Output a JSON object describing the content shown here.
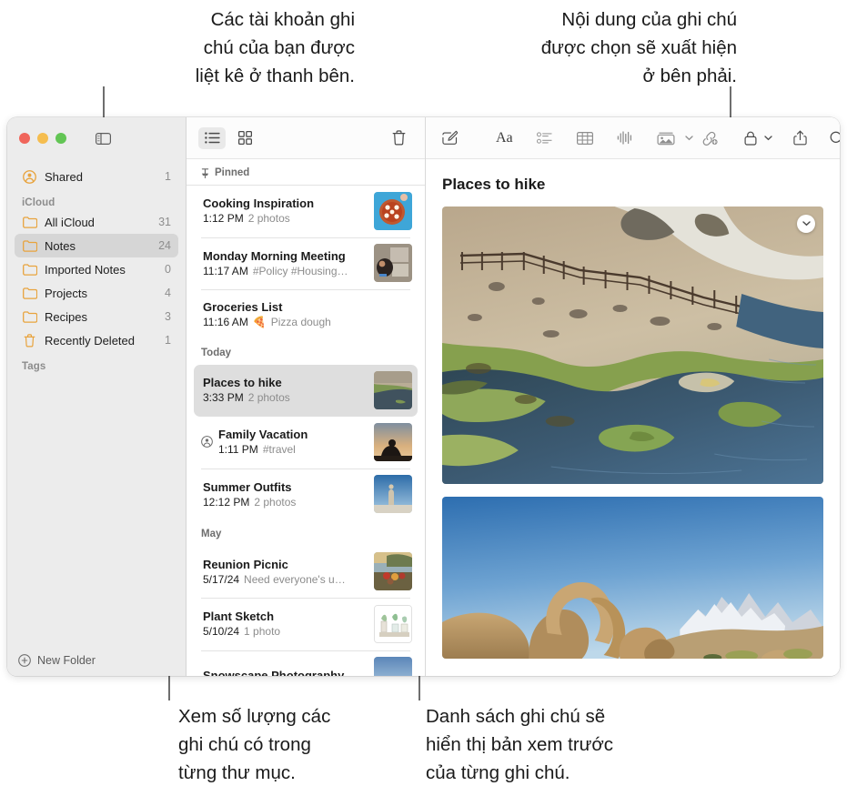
{
  "callouts": {
    "top_left": "Các tài khoản ghi\nchú của bạn được\nliệt kê ở thanh bên.",
    "top_right": "Nội dung của ghi chú\nđược chọn sẽ xuất hiện\nở bên phải.",
    "bottom_left": "Xem số lượng các\nghi chú có trong\ntừng thư mục.",
    "bottom_right": "Danh sách ghi chú sẽ\nhiển thị bản xem trước\ncủa từng ghi chú."
  },
  "window": {
    "traffic_lights": {
      "close": "close-button",
      "minimize": "minimize-button",
      "zoom": "zoom-button"
    },
    "sidebar_toggle": "sidebar-toggle"
  },
  "sidebar": {
    "shared": {
      "label": "Shared",
      "count": "1"
    },
    "sections": [
      {
        "title": "iCloud",
        "items": [
          {
            "label": "All iCloud",
            "count": "31",
            "icon": "folder-icon",
            "selected": false
          },
          {
            "label": "Notes",
            "count": "24",
            "icon": "folder-icon",
            "selected": true
          },
          {
            "label": "Imported Notes",
            "count": "0",
            "icon": "folder-icon",
            "selected": false
          },
          {
            "label": "Projects",
            "count": "4",
            "icon": "folder-icon",
            "selected": false
          },
          {
            "label": "Recipes",
            "count": "3",
            "icon": "folder-icon",
            "selected": false
          },
          {
            "label": "Recently Deleted",
            "count": "1",
            "icon": "trash-icon",
            "selected": false
          }
        ]
      },
      {
        "title": "Tags",
        "items": []
      }
    ],
    "new_folder_label": "New Folder"
  },
  "notes_list": {
    "toolbar": {
      "list_view": "list-view-icon",
      "gallery_view": "gallery-view-icon",
      "delete": "trash-icon"
    },
    "groups": [
      {
        "label": "Pinned",
        "icon": "pin-icon",
        "notes": [
          {
            "title": "Cooking Inspiration",
            "time": "1:12 PM",
            "preview": "2 photos",
            "thumb": "pizza",
            "shared": false,
            "selected": false
          },
          {
            "title": "Monday Morning Meeting",
            "time": "11:17 AM",
            "preview": "#Policy #Housing…",
            "thumb": "meeting",
            "shared": false,
            "selected": false
          },
          {
            "title": "Groceries List",
            "time": "11:16 AM",
            "preview": "Pizza dough",
            "emoji": "🍕",
            "thumb": null,
            "shared": false,
            "selected": false
          }
        ]
      },
      {
        "label": "Today",
        "notes": [
          {
            "title": "Places to hike",
            "time": "3:33 PM",
            "preview": "2 photos",
            "thumb": "hike",
            "shared": false,
            "selected": true
          },
          {
            "title": "Family Vacation",
            "time": "1:11 PM",
            "preview": "#travel",
            "thumb": "vacation",
            "shared": true,
            "selected": false
          },
          {
            "title": "Summer Outfits",
            "time": "12:12 PM",
            "preview": "2 photos",
            "thumb": "outfits",
            "shared": false,
            "selected": false
          }
        ]
      },
      {
        "label": "May",
        "notes": [
          {
            "title": "Reunion Picnic",
            "time": "5/17/24",
            "preview": "Need everyone's u…",
            "thumb": "picnic",
            "shared": false,
            "selected": false
          },
          {
            "title": "Plant Sketch",
            "time": "5/10/24",
            "preview": "1 photo",
            "thumb": "plants",
            "shared": false,
            "selected": false
          },
          {
            "title": "Snowscape Photography",
            "time": "",
            "preview": "",
            "thumb": "snow",
            "shared": false,
            "selected": false
          }
        ]
      }
    ]
  },
  "editor": {
    "toolbar": [
      {
        "name": "compose-icon",
        "label": ""
      },
      {
        "name": "format-aa-icon",
        "label": "Aa"
      },
      {
        "name": "checklist-icon",
        "label": ""
      },
      {
        "name": "table-icon",
        "label": ""
      },
      {
        "name": "audio-waveform-icon",
        "label": ""
      },
      {
        "name": "media-icon",
        "label": ""
      },
      {
        "name": "link-add-icon",
        "label": ""
      },
      {
        "name": "lock-icon",
        "label": ""
      },
      {
        "name": "share-icon",
        "label": ""
      },
      {
        "name": "search-icon",
        "label": ""
      }
    ],
    "note_title": "Places to hike",
    "images": [
      {
        "name": "hot-creek-river-photo",
        "menu": "chevron-down-icon"
      },
      {
        "name": "mobius-arch-photo",
        "menu": null
      }
    ]
  },
  "colors": {
    "folder_yellow": "#e8a33d",
    "shared_orange": "#e8a33d",
    "selection_gray": "#d6d6d6",
    "sidebar_bg": "#ececec",
    "text": "#1b1b1b",
    "muted": "#8c8c8c"
  }
}
